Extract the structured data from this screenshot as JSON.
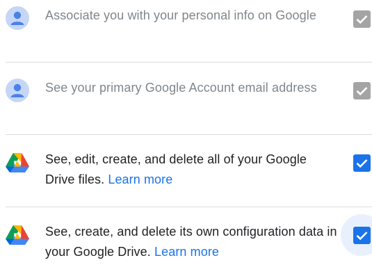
{
  "permissions": [
    {
      "text": "Associate you with your personal info on Google",
      "link": "",
      "icon": "person-icon",
      "checked": true,
      "disabled": true
    },
    {
      "text": "See your primary Google Account email address",
      "link": "",
      "icon": "person-icon",
      "checked": true,
      "disabled": true
    },
    {
      "text": "See, edit, create, and delete all of your Google Drive files.",
      "link": "Learn more",
      "icon": "google-drive-icon",
      "checked": true,
      "disabled": false
    },
    {
      "text": "See, create, and delete its own configuration data in your Google Drive.",
      "link": "Learn more",
      "icon": "google-drive-icon",
      "checked": true,
      "disabled": false
    }
  ],
  "colors": {
    "checkbox_checked": "#1a73e8",
    "checkbox_disabled": "#a4a4a4",
    "link": "#1a73e8",
    "text_disabled": "#80868b",
    "text": "#202124"
  }
}
